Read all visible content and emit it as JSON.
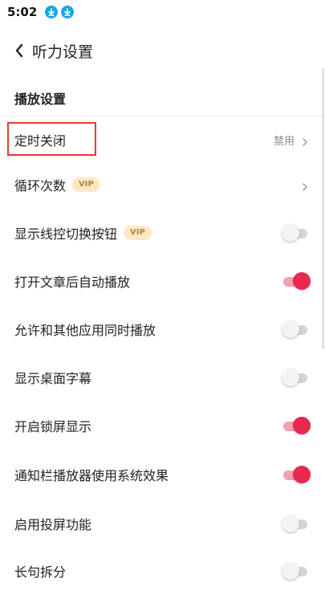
{
  "status_bar": {
    "time": "5:02",
    "icons": [
      "download-icon",
      "download-icon"
    ],
    "accent": "#1aa3e8"
  },
  "header": {
    "back_icon": "chevron-left-icon",
    "title": "听力设置"
  },
  "section": {
    "title": "播放设置"
  },
  "colors": {
    "toggle_on": "#e8284c",
    "toggle_off": "#d5d5d5",
    "highlight": "#e53935",
    "vip_bg": "#fbe8c6"
  },
  "settings": [
    {
      "label": "定时关闭",
      "value": "禁用",
      "type": "link"
    },
    {
      "label": "循环次数",
      "badge": "VIP",
      "type": "link"
    },
    {
      "label": "显示线控切换按钮",
      "badge": "VIP",
      "type": "toggle",
      "on": false
    },
    {
      "label": "打开文章后自动播放",
      "type": "toggle",
      "on": true
    },
    {
      "label": "允许和其他应用同时播放",
      "type": "toggle",
      "on": false
    },
    {
      "label": "显示桌面字幕",
      "type": "toggle",
      "on": false
    },
    {
      "label": "开启锁屏显示",
      "type": "toggle",
      "on": true
    },
    {
      "label": "通知栏播放器使用系统效果",
      "type": "toggle",
      "on": true
    },
    {
      "label": "启用投屏功能",
      "type": "toggle",
      "on": false
    },
    {
      "label": "长句拆分",
      "type": "toggle",
      "on": false
    }
  ]
}
